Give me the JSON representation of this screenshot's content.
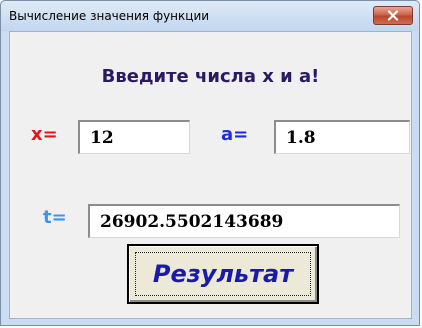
{
  "window": {
    "title": "Вычисление значения функции"
  },
  "heading": "Введите числа х и а!",
  "inputs": {
    "x_label": "x=",
    "x_value": "12",
    "a_label": "a=",
    "a_value": "1.8"
  },
  "output": {
    "t_label": "t=",
    "t_value": "26902.5502143689"
  },
  "button": {
    "label": "Результат"
  },
  "colors": {
    "x_label": "#e8141c",
    "a_label": "#1d2ae0",
    "t_label": "#3a95f0",
    "heading": "#2b1a60",
    "button_text": "#1a1aa8"
  },
  "icons": {
    "close": "close-icon"
  }
}
